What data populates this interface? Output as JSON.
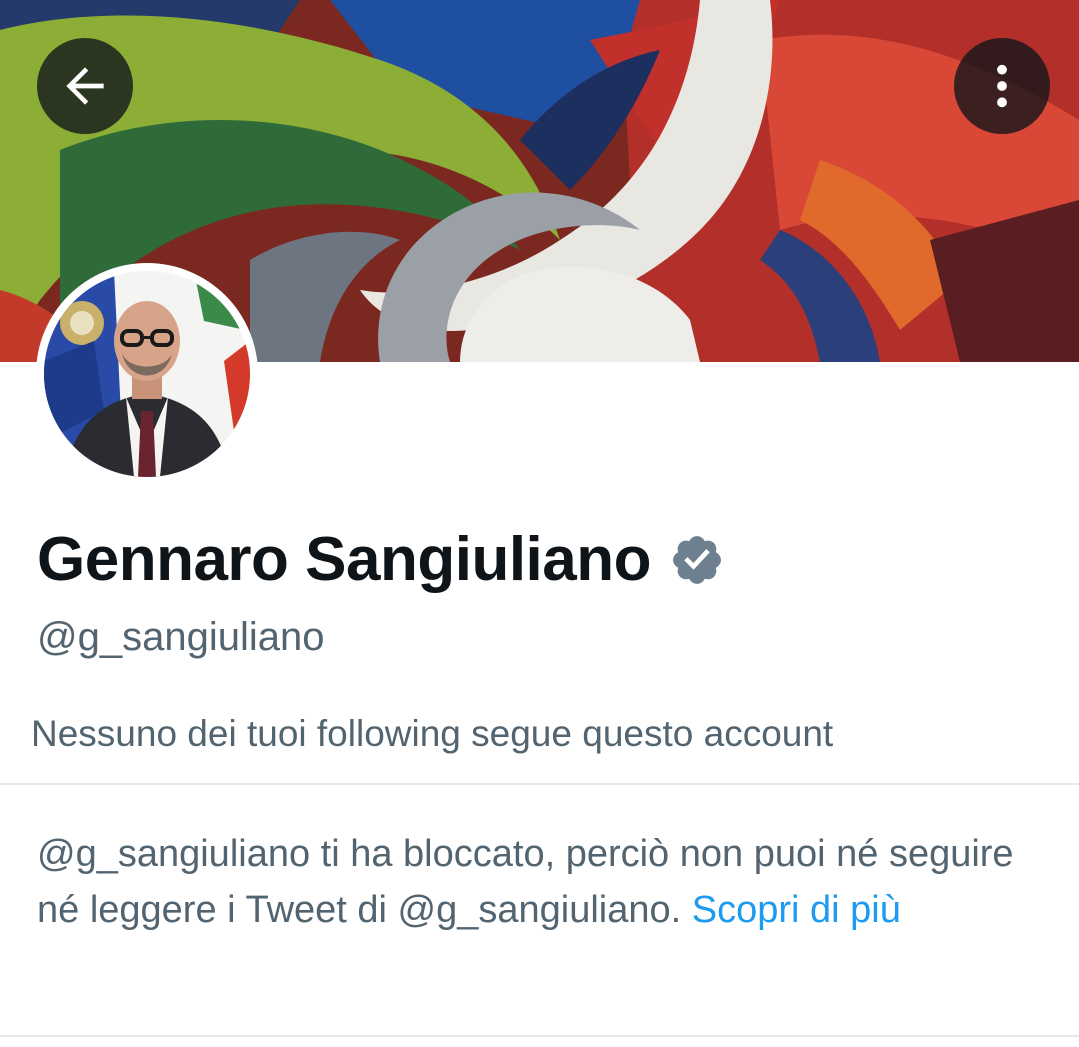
{
  "header": {
    "back_icon": "arrow-left-icon",
    "more_icon": "more-vertical-icon",
    "button_background": "#0f1419"
  },
  "profile": {
    "display_name": "Gennaro Sangiuliano",
    "verified": true,
    "verified_badge_color": "#6e7f8f",
    "handle": "@g_sangiuliano",
    "followers_you_know": "Nessuno dei tuoi following segue questo account"
  },
  "block_notice": {
    "message": "@g_sangiuliano ti ha bloccato, perciò non puoi né seguire né leggere i Tweet di @g_sangiuliano.",
    "link_text": "Scopri di più",
    "link_color": "#1d9bf0"
  }
}
